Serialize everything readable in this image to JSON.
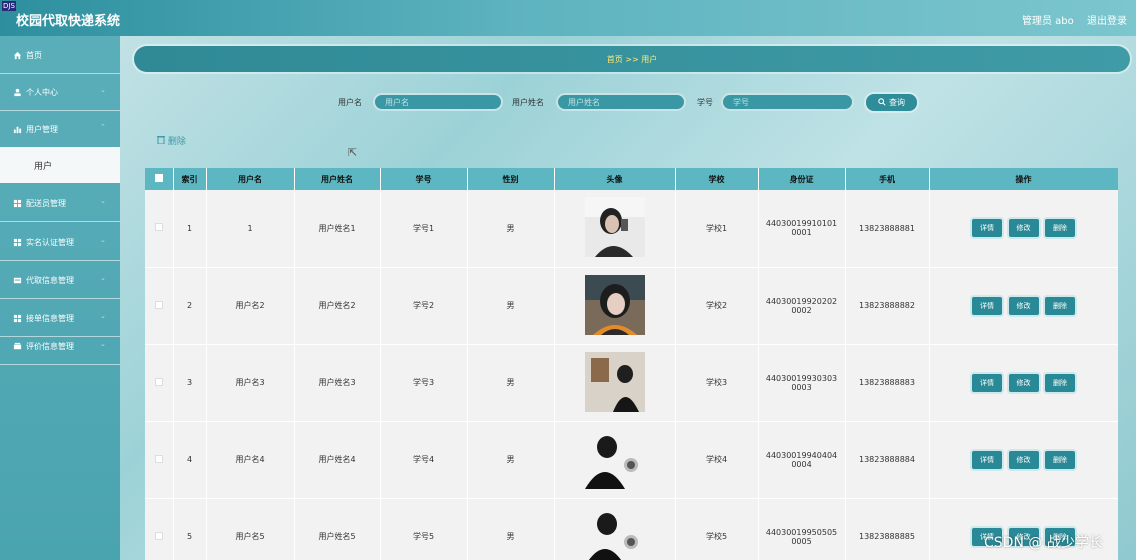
{
  "header": {
    "logo_badge": "DJS",
    "title": "校园代取快递系统",
    "admin": "管理员 abo",
    "logout": "退出登录"
  },
  "sidebar": {
    "items": [
      {
        "label": "首页",
        "icon": "home-icon"
      },
      {
        "label": "个人中心",
        "icon": "user-icon"
      },
      {
        "label": "用户管理",
        "icon": "chart-icon"
      },
      {
        "label": "配送员管理",
        "icon": "grid-icon"
      },
      {
        "label": "实名认证管理",
        "icon": "grid-icon"
      },
      {
        "label": "代取信息管理",
        "icon": "list-icon"
      },
      {
        "label": "接单信息管理",
        "icon": "grid-icon"
      },
      {
        "label": "评价信息管理",
        "icon": "inbox-icon"
      }
    ],
    "active_sub": "用户"
  },
  "breadcrumb": "首页 >> 用户",
  "search": {
    "username_label": "用户名",
    "username_placeholder": "用户名",
    "realname_label": "用户姓名",
    "realname_placeholder": "用户姓名",
    "studentid_label": "学号",
    "studentid_placeholder": "学号",
    "query_label": "查询"
  },
  "toolbar": {
    "delete_label": "删除"
  },
  "table": {
    "headers": [
      "",
      "索引",
      "用户名",
      "用户姓名",
      "学号",
      "性别",
      "头像",
      "学校",
      "身份证",
      "手机",
      "操作"
    ],
    "rows": [
      {
        "index": "1",
        "username": "1",
        "realname": "用户姓名1",
        "studentid": "学号1",
        "gender": "男",
        "school": "学校1",
        "idcard1": "44030019910101",
        "idcard2": "0001",
        "phone": "13823888881"
      },
      {
        "index": "2",
        "username": "用户名2",
        "realname": "用户姓名2",
        "studentid": "学号2",
        "gender": "男",
        "school": "学校2",
        "idcard1": "44030019920202",
        "idcard2": "0002",
        "phone": "13823888882"
      },
      {
        "index": "3",
        "username": "用户名3",
        "realname": "用户姓名3",
        "studentid": "学号3",
        "gender": "男",
        "school": "学校3",
        "idcard1": "44030019930303",
        "idcard2": "0003",
        "phone": "13823888883"
      },
      {
        "index": "4",
        "username": "用户名4",
        "realname": "用户姓名4",
        "studentid": "学号4",
        "gender": "男",
        "school": "学校4",
        "idcard1": "44030019940404",
        "idcard2": "0004",
        "phone": "13823888884"
      },
      {
        "index": "5",
        "username": "用户名5",
        "realname": "用户姓名5",
        "studentid": "学号5",
        "gender": "男",
        "school": "学校5",
        "idcard1": "44030019950505",
        "idcard2": "0005",
        "phone": "13823888885"
      }
    ],
    "actions": {
      "detail": "详情",
      "edit": "修改",
      "delete": "删除"
    }
  },
  "watermark": "CSDN @ 战少学长"
}
